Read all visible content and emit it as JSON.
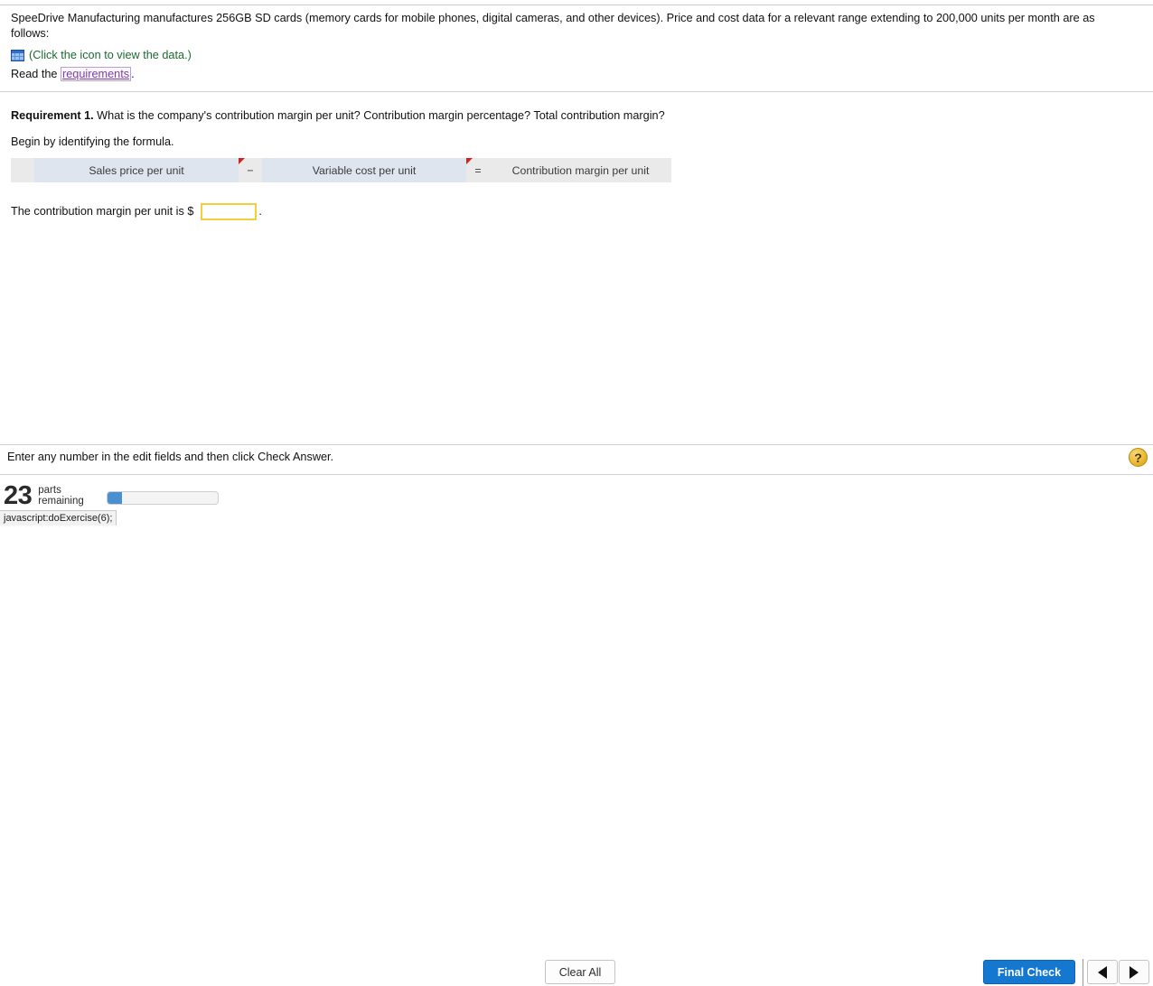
{
  "problem": {
    "statement": "SpeeDrive Manufacturing manufactures 256GB SD cards (memory cards for mobile phones, digital cameras, and other devices). Price and cost data for a relevant range extending to 200,000 units per month are as follows:",
    "data_icon_name": "table-grid-icon",
    "data_link_text": "(Click the icon to view the data.)",
    "read_prefix": "Read the ",
    "read_link_text": "requirements",
    "read_suffix": "."
  },
  "requirement": {
    "label": "Requirement 1.",
    "question": " What is the company's contribution margin per unit? Contribution margin percentage? Total contribution margin?",
    "begin_instruction": "Begin by identifying the formula."
  },
  "formula": {
    "term1": "Sales price per unit",
    "operator1": "−",
    "term2": "Variable cost per unit",
    "operator2": "=",
    "result": "Contribution margin per unit"
  },
  "answer": {
    "prompt_prefix": "The contribution margin per unit is $",
    "value": "",
    "placeholder": "",
    "suffix": "."
  },
  "hint": {
    "text": "Enter any number in the edit fields and then click Check Answer."
  },
  "help": {
    "glyph": "?",
    "name": "help-question-icon"
  },
  "footer": {
    "parts_count": "23",
    "parts_label": "parts remaining",
    "progress_percent": 13,
    "clear_all_label": "Clear All",
    "final_check_label": "Final Check",
    "prev_icon": "triangle-left-icon",
    "next_icon": "triangle-right-icon"
  },
  "status_bar": {
    "text": "javascript:doExercise(6);"
  },
  "colors": {
    "accent_blue": "#1478d0",
    "progress_blue": "#4a90d0",
    "formula_cell": "#dfe5ef",
    "formula_bg": "#eaeaea",
    "flag_red": "#d32020",
    "input_border": "#f2cf3f",
    "data_link_green": "#1d6b2f",
    "req_link_purple": "#7a3fa8",
    "help_gold": "#edb934"
  }
}
